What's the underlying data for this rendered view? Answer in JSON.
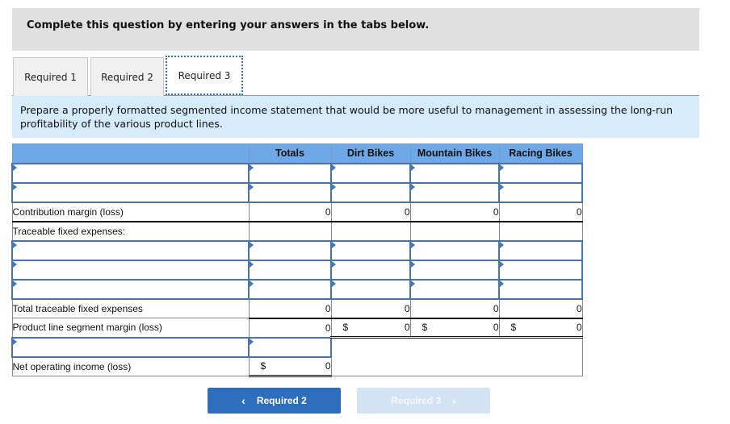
{
  "banner": {
    "text": "Complete this question by entering your answers in the tabs below."
  },
  "tabs": [
    {
      "label": "Required 1",
      "active": false
    },
    {
      "label": "Required 2",
      "active": false
    },
    {
      "label": "Required 3",
      "active": true
    }
  ],
  "instructions": "Prepare a properly formatted segmented income statement that would be more useful to management in assessing the long-run profitability of the various product lines.",
  "table": {
    "headers": [
      "",
      "Totals",
      "Dirt Bikes",
      "Mountain Bikes",
      "Racing Bikes"
    ],
    "rows": {
      "contribution_margin": {
        "label": "Contribution margin (loss)",
        "values": [
          "0",
          "0",
          "0",
          "0"
        ]
      },
      "traceable_fixed": {
        "label": "Traceable fixed expenses:"
      },
      "total_traceable_fixed": {
        "label": "Total traceable fixed expenses",
        "values": [
          "0",
          "0",
          "0",
          "0"
        ]
      },
      "segment_margin": {
        "label": "Product line segment margin (loss)",
        "values": [
          "0",
          "0",
          "0",
          "0"
        ],
        "currency": [
          "",
          "$",
          "$",
          "$"
        ]
      },
      "net_operating_income": {
        "label": "Net operating income (loss)",
        "value": "0",
        "currency": "$"
      }
    }
  },
  "nav": {
    "prev_label": "Required 2",
    "prev_icon": "chevron-left-icon",
    "next_label": "Required 3",
    "next_icon": "chevron-right-icon"
  }
}
